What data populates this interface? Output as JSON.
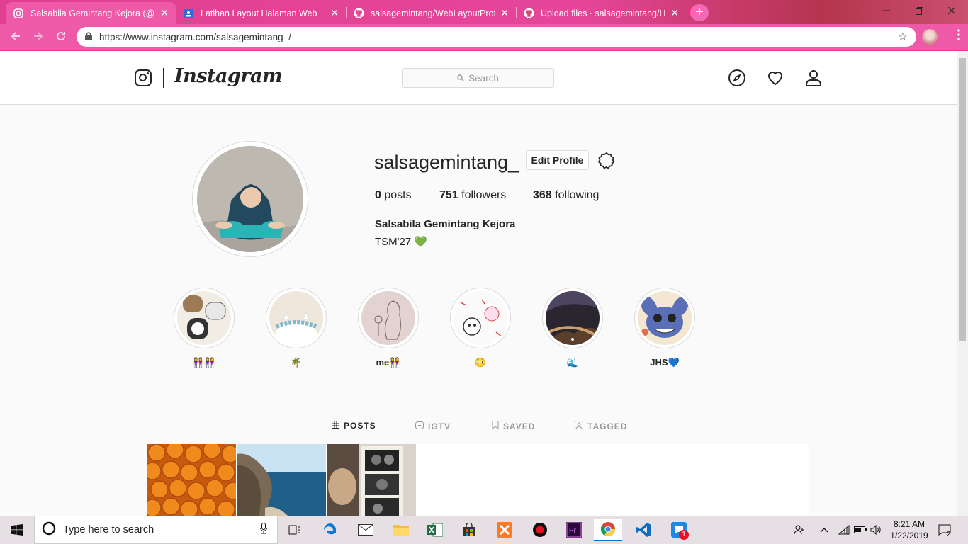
{
  "browser": {
    "tabs": [
      {
        "title": "Salsabila Gemintang Kejora (@sa",
        "icon": "instagram-icon",
        "active": true
      },
      {
        "title": "Latihan Layout Halaman Web",
        "icon": "classroom-icon",
        "active": false
      },
      {
        "title": "salsagemintang/WebLayoutProfil",
        "icon": "github-icon",
        "active": false
      },
      {
        "title": "Upload files · salsagemintang/Ha",
        "icon": "github-icon",
        "active": false
      }
    ],
    "close_glyph": "✕",
    "new_tab_glyph": "+",
    "url": "https://www.instagram.com/salsagemintang_/",
    "accent_color": "#ee59a8"
  },
  "instagram": {
    "wordmark": "Instagram",
    "search_placeholder": "Search",
    "username": "salsagemintang_",
    "edit_profile_label": "Edit Profile",
    "stats": {
      "posts_count": "0",
      "posts_label": "posts",
      "followers_count": "751",
      "followers_label": "followers",
      "following_count": "368",
      "following_label": "following"
    },
    "full_name": "Salsabila Gemintang Kejora",
    "bio": "TSM'27 💚",
    "highlights": [
      {
        "label": "👭👭"
      },
      {
        "label": "🌴"
      },
      {
        "label": "me👭"
      },
      {
        "label": "😳"
      },
      {
        "label": "🌊"
      },
      {
        "label": "JHS💙"
      }
    ],
    "profile_tabs": [
      {
        "label": "POSTS",
        "icon": "grid-icon",
        "active": true
      },
      {
        "label": "IGTV",
        "icon": "igtv-icon",
        "active": false
      },
      {
        "label": "SAVED",
        "icon": "bookmark-icon",
        "active": false
      },
      {
        "label": "TAGGED",
        "icon": "tagged-icon",
        "active": false
      }
    ]
  },
  "taskbar": {
    "search_placeholder": "Type here to search",
    "time": "8:21 AM",
    "date": "1/22/2019",
    "notification_count": "2",
    "chat_badge": "1"
  }
}
